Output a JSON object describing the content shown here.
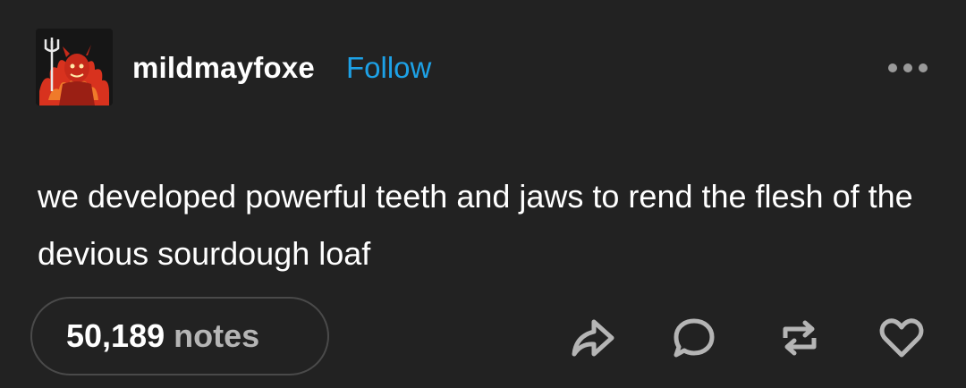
{
  "post": {
    "username": "mildmayfoxe",
    "follow_label": "Follow",
    "body": "we developed powerful teeth and jaws to rend the flesh of the devious sourdough loaf",
    "notes_count": "50,189",
    "notes_label": "notes"
  },
  "icons": {
    "avatar": "devil-avatar",
    "more": "more-options-icon",
    "share": "share-icon",
    "reply": "reply-icon",
    "reblog": "reblog-icon",
    "like": "heart-icon"
  },
  "colors": {
    "background": "#222222",
    "text": "#ffffff",
    "follow": "#1da1e6",
    "muted": "#b5b5b5",
    "pill_border": "#4a4a4a",
    "avatar_red": "#d8321e"
  }
}
